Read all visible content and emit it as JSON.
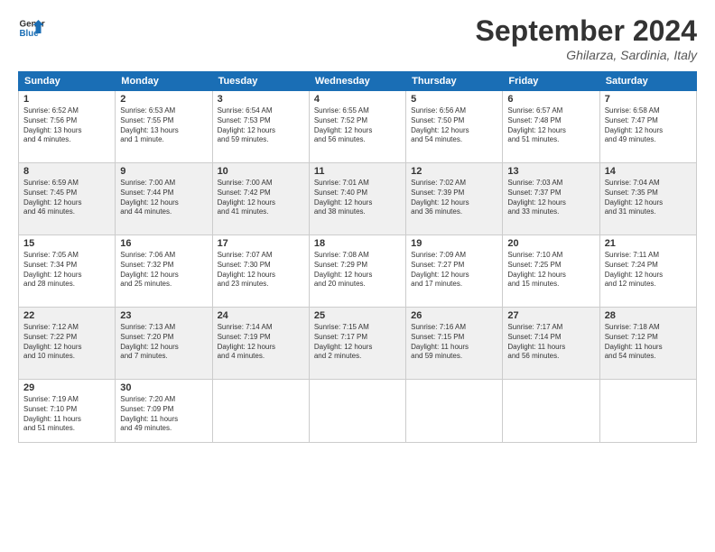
{
  "logo": {
    "line1": "General",
    "line2": "Blue"
  },
  "title": "September 2024",
  "location": "Ghilarza, Sardinia, Italy",
  "headers": [
    "Sunday",
    "Monday",
    "Tuesday",
    "Wednesday",
    "Thursday",
    "Friday",
    "Saturday"
  ],
  "weeks": [
    [
      {
        "day": "1",
        "info": "Sunrise: 6:52 AM\nSunset: 7:56 PM\nDaylight: 13 hours\nand 4 minutes."
      },
      {
        "day": "2",
        "info": "Sunrise: 6:53 AM\nSunset: 7:55 PM\nDaylight: 13 hours\nand 1 minute."
      },
      {
        "day": "3",
        "info": "Sunrise: 6:54 AM\nSunset: 7:53 PM\nDaylight: 12 hours\nand 59 minutes."
      },
      {
        "day": "4",
        "info": "Sunrise: 6:55 AM\nSunset: 7:52 PM\nDaylight: 12 hours\nand 56 minutes."
      },
      {
        "day": "5",
        "info": "Sunrise: 6:56 AM\nSunset: 7:50 PM\nDaylight: 12 hours\nand 54 minutes."
      },
      {
        "day": "6",
        "info": "Sunrise: 6:57 AM\nSunset: 7:48 PM\nDaylight: 12 hours\nand 51 minutes."
      },
      {
        "day": "7",
        "info": "Sunrise: 6:58 AM\nSunset: 7:47 PM\nDaylight: 12 hours\nand 49 minutes."
      }
    ],
    [
      {
        "day": "8",
        "info": "Sunrise: 6:59 AM\nSunset: 7:45 PM\nDaylight: 12 hours\nand 46 minutes."
      },
      {
        "day": "9",
        "info": "Sunrise: 7:00 AM\nSunset: 7:44 PM\nDaylight: 12 hours\nand 44 minutes."
      },
      {
        "day": "10",
        "info": "Sunrise: 7:00 AM\nSunset: 7:42 PM\nDaylight: 12 hours\nand 41 minutes."
      },
      {
        "day": "11",
        "info": "Sunrise: 7:01 AM\nSunset: 7:40 PM\nDaylight: 12 hours\nand 38 minutes."
      },
      {
        "day": "12",
        "info": "Sunrise: 7:02 AM\nSunset: 7:39 PM\nDaylight: 12 hours\nand 36 minutes."
      },
      {
        "day": "13",
        "info": "Sunrise: 7:03 AM\nSunset: 7:37 PM\nDaylight: 12 hours\nand 33 minutes."
      },
      {
        "day": "14",
        "info": "Sunrise: 7:04 AM\nSunset: 7:35 PM\nDaylight: 12 hours\nand 31 minutes."
      }
    ],
    [
      {
        "day": "15",
        "info": "Sunrise: 7:05 AM\nSunset: 7:34 PM\nDaylight: 12 hours\nand 28 minutes."
      },
      {
        "day": "16",
        "info": "Sunrise: 7:06 AM\nSunset: 7:32 PM\nDaylight: 12 hours\nand 25 minutes."
      },
      {
        "day": "17",
        "info": "Sunrise: 7:07 AM\nSunset: 7:30 PM\nDaylight: 12 hours\nand 23 minutes."
      },
      {
        "day": "18",
        "info": "Sunrise: 7:08 AM\nSunset: 7:29 PM\nDaylight: 12 hours\nand 20 minutes."
      },
      {
        "day": "19",
        "info": "Sunrise: 7:09 AM\nSunset: 7:27 PM\nDaylight: 12 hours\nand 17 minutes."
      },
      {
        "day": "20",
        "info": "Sunrise: 7:10 AM\nSunset: 7:25 PM\nDaylight: 12 hours\nand 15 minutes."
      },
      {
        "day": "21",
        "info": "Sunrise: 7:11 AM\nSunset: 7:24 PM\nDaylight: 12 hours\nand 12 minutes."
      }
    ],
    [
      {
        "day": "22",
        "info": "Sunrise: 7:12 AM\nSunset: 7:22 PM\nDaylight: 12 hours\nand 10 minutes."
      },
      {
        "day": "23",
        "info": "Sunrise: 7:13 AM\nSunset: 7:20 PM\nDaylight: 12 hours\nand 7 minutes."
      },
      {
        "day": "24",
        "info": "Sunrise: 7:14 AM\nSunset: 7:19 PM\nDaylight: 12 hours\nand 4 minutes."
      },
      {
        "day": "25",
        "info": "Sunrise: 7:15 AM\nSunset: 7:17 PM\nDaylight: 12 hours\nand 2 minutes."
      },
      {
        "day": "26",
        "info": "Sunrise: 7:16 AM\nSunset: 7:15 PM\nDaylight: 11 hours\nand 59 minutes."
      },
      {
        "day": "27",
        "info": "Sunrise: 7:17 AM\nSunset: 7:14 PM\nDaylight: 11 hours\nand 56 minutes."
      },
      {
        "day": "28",
        "info": "Sunrise: 7:18 AM\nSunset: 7:12 PM\nDaylight: 11 hours\nand 54 minutes."
      }
    ],
    [
      {
        "day": "29",
        "info": "Sunrise: 7:19 AM\nSunset: 7:10 PM\nDaylight: 11 hours\nand 51 minutes."
      },
      {
        "day": "30",
        "info": "Sunrise: 7:20 AM\nSunset: 7:09 PM\nDaylight: 11 hours\nand 49 minutes."
      },
      {
        "day": "",
        "info": ""
      },
      {
        "day": "",
        "info": ""
      },
      {
        "day": "",
        "info": ""
      },
      {
        "day": "",
        "info": ""
      },
      {
        "day": "",
        "info": ""
      }
    ]
  ]
}
